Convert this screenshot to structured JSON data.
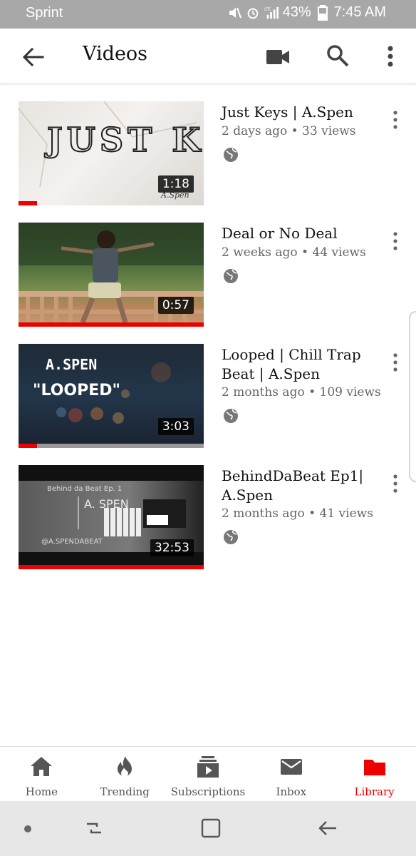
{
  "status_bar": {
    "carrier": "Sprint",
    "battery": "43%",
    "time": "7:45 AM",
    "network": "LTE"
  },
  "app_bar": {
    "title": "Videos",
    "icons": [
      "back-arrow-icon",
      "videocam-icon",
      "search-icon",
      "more-vert-icon"
    ]
  },
  "videos": [
    {
      "title": "Just Keys | A.Spen",
      "meta": "2 days ago • 33 views",
      "duration": "1:18",
      "progress": 0.1,
      "thumb_text": "JUST KEYS",
      "thumb_sub": "A.Spen"
    },
    {
      "title": "Deal or No Deal",
      "meta": "2 weeks ago • 44 views",
      "duration": "0:57",
      "progress": 1.0
    },
    {
      "title": "Looped | Chill Trap Beat | A.Spen",
      "meta": "2 months ago • 109 views",
      "duration": "3:03",
      "progress": 0.1,
      "thumb_text": "A.SPEN",
      "thumb_sub": "\"LOOPED\""
    },
    {
      "title": "BehindDaBeat Ep1| A.Spen",
      "meta": "2 months ago • 41 views",
      "duration": "32:53",
      "progress": 1.0,
      "thumb_text": "Behind da Beat Ep. 1",
      "thumb_sub": "A. SPEN",
      "thumb_handle": "@A.SPENDABEAT"
    }
  ],
  "bottom_nav": [
    {
      "label": "Home",
      "icon": "home-icon",
      "active": false
    },
    {
      "label": "Trending",
      "icon": "flame-icon",
      "active": false
    },
    {
      "label": "Subscriptions",
      "icon": "subscriptions-icon",
      "active": false
    },
    {
      "label": "Inbox",
      "icon": "mail-icon",
      "active": false
    },
    {
      "label": "Library",
      "icon": "folder-icon",
      "active": true
    }
  ],
  "colors": {
    "accent": "#e00000",
    "status_bar": "#a8a8a8",
    "system_nav": "#e7e7e7"
  }
}
